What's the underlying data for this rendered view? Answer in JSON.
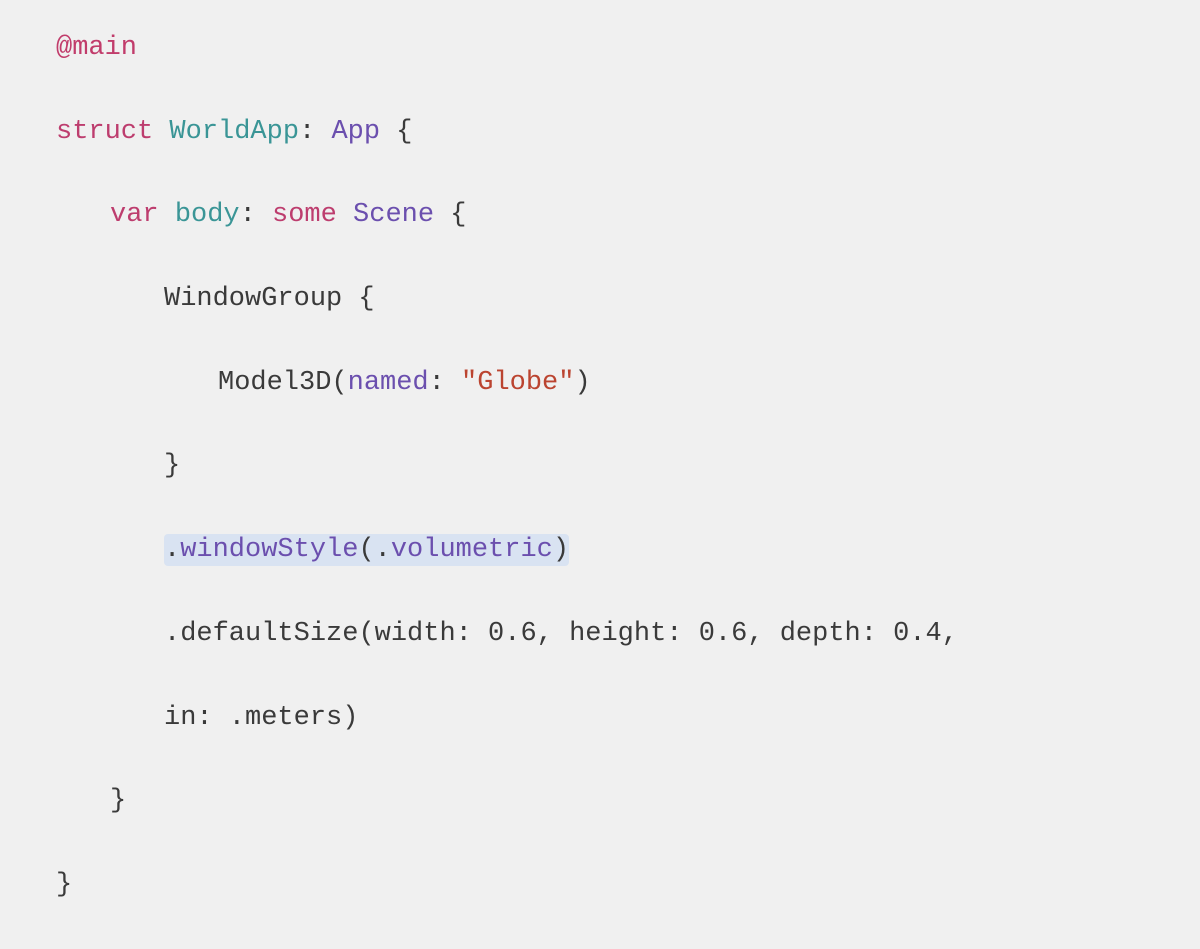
{
  "code": {
    "l1": {
      "atmain": "@main"
    },
    "l2": {
      "struct": "struct",
      "name": "WorldApp",
      "colon": ":",
      "protocol": "App",
      "brace": " {"
    },
    "l3": {
      "var": "var",
      "body": "body",
      "colon": ":",
      "some": "some",
      "scene": "Scene",
      "brace": " {"
    },
    "l4": {
      "windowgroup": "WindowGroup",
      "brace": " {"
    },
    "l5": {
      "model3d": "Model3D",
      "open": "(",
      "named": "named",
      "colon": ":",
      "str": "\"Globe\"",
      "close": ")"
    },
    "l6": {
      "close": "}"
    },
    "l7": {
      "dot": ".",
      "method": "windowStyle",
      "open": "(",
      "dot2": ".",
      "arg": "volumetric",
      "close": ")"
    },
    "l8": {
      "dot": ".",
      "method": "defaultSize",
      "open": "(",
      "p1": "width",
      "c1": ":",
      "v1": " 0.6",
      "comma1": ",",
      "p2": "height",
      "c2": ":",
      "v2": " 0.6",
      "comma2": ",",
      "p3": "depth",
      "c3": ":",
      "v3": " 0.4",
      "comma3": ","
    },
    "l9": {
      "p4": "in",
      "c4": ":",
      "dot": " .",
      "unit": "meters",
      "close": ")"
    },
    "l10": {
      "close": "}"
    },
    "l11": {
      "close": "}"
    }
  }
}
